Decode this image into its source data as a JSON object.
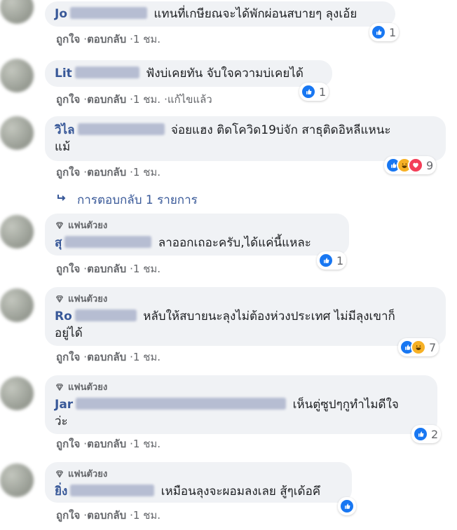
{
  "actions": {
    "like": "ถูกใจ",
    "reply": "ตอบกลับ",
    "sep": "·"
  },
  "badge_label": "แฟนตัวยง",
  "reply_summary": "การตอบกลับ 1 รายการ",
  "comments": [
    {
      "name_visible": "Jo",
      "text": "แทนที่เกษียณจะได้พักผ่อนสบายๆ ลุงเอ้ย",
      "time": "1 ชม.",
      "reaction_count": "1",
      "edited": ""
    },
    {
      "name_visible": "Lit",
      "text": "ฟังบ่เคยทัน จับใจความบ่เคยได้",
      "time": "1 ชม.",
      "reaction_count": "1",
      "edited": "แก้ไขแล้ว"
    },
    {
      "name_visible": "วิไล",
      "text": "จ่อยแฮง ติดโควิด19บ่จัก สาธุติดอิหลีแหนะ",
      "text2": "แม้",
      "time": "1 ชม.",
      "reaction_count": "9",
      "edited": ""
    },
    {
      "name_visible": "สุ",
      "text": "ลาออกเถอะครับ,ได้แค่นี้แหละ",
      "time": "1 ชม.",
      "reaction_count": "1",
      "edited": ""
    },
    {
      "name_visible": "Ro",
      "text": "หลับให้สบายนะลุงไม่ต้องห่วงประเทศ ไม่มีลุงเขาก็",
      "text2": "อยู่ได้",
      "time": "1 ชม.",
      "reaction_count": "7",
      "edited": ""
    },
    {
      "name_visible": "Jar",
      "text": "เห็นตู่ซูปๆกูทำไมดีใจ",
      "text2": "ว่ะ",
      "time": "1 ชม.",
      "reaction_count": "2",
      "edited": ""
    },
    {
      "name_visible": "ยิ่ง",
      "text": "เหมือนลุงจะผอมลงเลย สู้ๆเด้อคึ",
      "time": "1 ชม.",
      "reaction_count": "",
      "edited": ""
    }
  ],
  "colors": {
    "like": "#1877f2",
    "haha": "#f7b125",
    "love": "#f33e58",
    "name": "#385898"
  }
}
